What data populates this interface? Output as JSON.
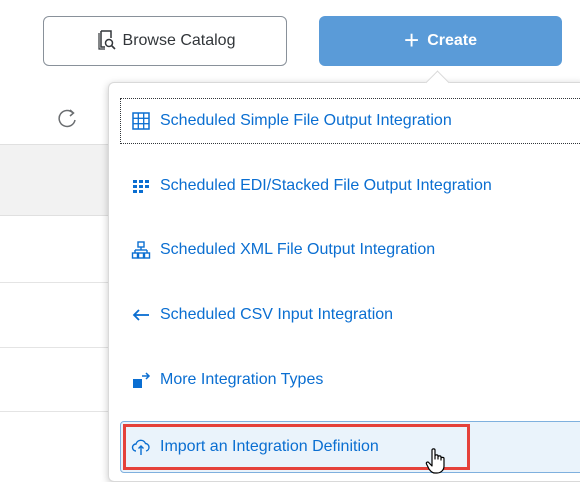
{
  "toolbar": {
    "browse_catalog_label": "Browse Catalog",
    "create_label": "Create",
    "create_plus": "+"
  },
  "menu": {
    "items": [
      {
        "label": "Scheduled Simple File Output Integration",
        "icon": "grid-table-icon"
      },
      {
        "label": "Scheduled EDI/Stacked File Output Integration",
        "icon": "stacked-records-icon"
      },
      {
        "label": "Scheduled XML File Output Integration",
        "icon": "xml-hierarchy-icon"
      },
      {
        "label": "Scheduled CSV Input Integration",
        "icon": "arrow-left-icon"
      },
      {
        "label": "More Integration Types",
        "icon": "more-types-icon"
      },
      {
        "label": "Import an Integration Definition",
        "icon": "cloud-upload-icon"
      }
    ]
  },
  "colors": {
    "accent_blue": "#0a6ed1",
    "create_button": "#5a9bd8",
    "highlight_red": "#e5413a"
  }
}
